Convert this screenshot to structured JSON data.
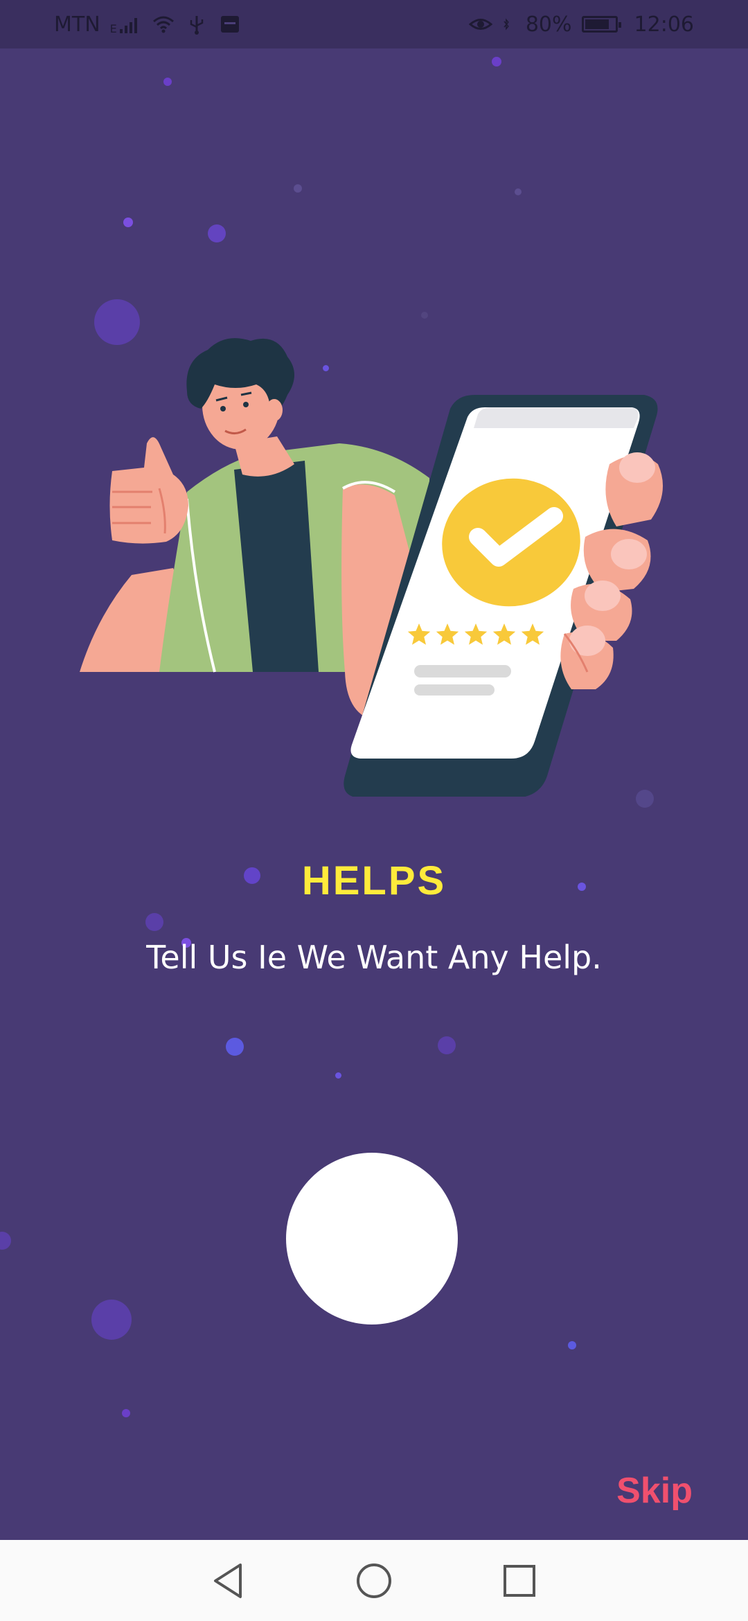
{
  "status_bar": {
    "carrier": "MTN",
    "network_type": "E",
    "battery_percent": "80%",
    "battery_level": 0.8,
    "time": "12:06",
    "icons": [
      "signal-icon",
      "wifi-icon",
      "usb-icon",
      "notification-icon",
      "eye-icon",
      "bluetooth-icon",
      "battery-icon"
    ]
  },
  "onboarding": {
    "title": "HELPS",
    "subtitle": "Tell Us Ie We Want Any Help.",
    "skip_label": "Skip",
    "rating_stars": 5,
    "illustration": "person-thumbs-up-holding-phone-with-checkmark"
  },
  "nav_bar": {
    "icons": [
      "back-icon",
      "home-icon",
      "recents-icon"
    ]
  },
  "colors": {
    "background": "#483A74",
    "status_bar": "#3A2F5F",
    "title": "#FFEB3B",
    "subtitle": "#FFFFFF",
    "skip": "#F0506E",
    "button": "#FFFFFF",
    "nav_bar": "#FAFAFA"
  }
}
